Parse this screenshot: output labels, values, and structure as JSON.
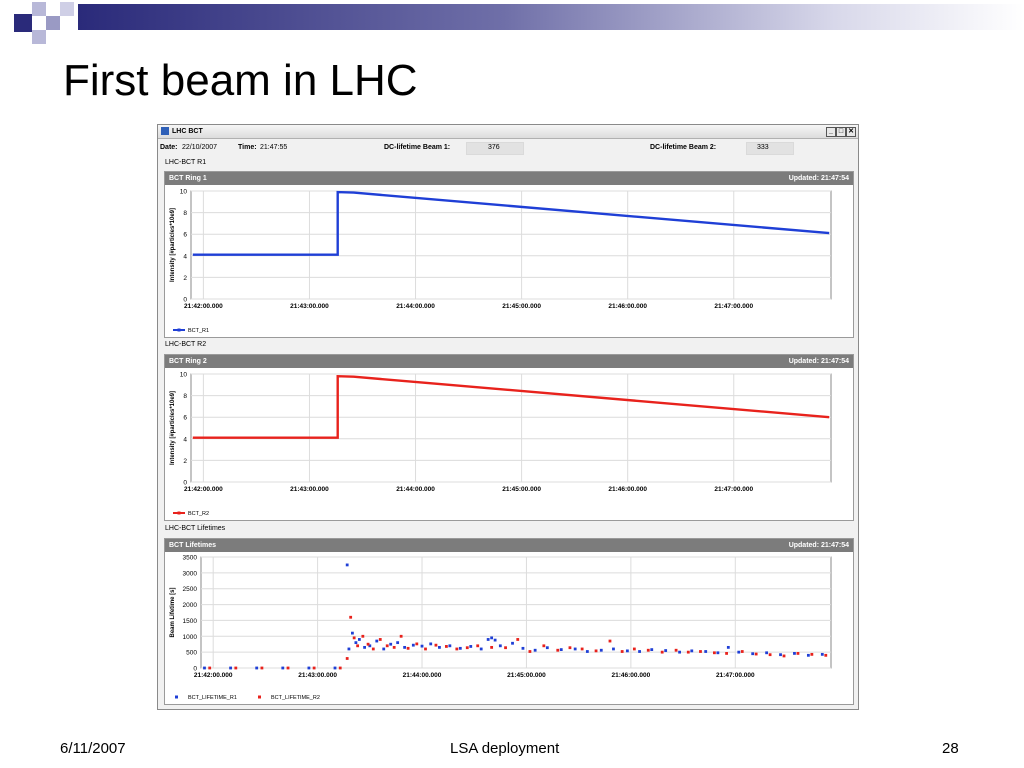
{
  "slide": {
    "title": "First beam in LHC"
  },
  "footer": {
    "date": "6/11/2007",
    "center": "LSA deployment",
    "page": "28"
  },
  "window": {
    "title": "LHC BCT",
    "date_label": "Date:",
    "date_value": "22/10/2007",
    "time_label": "Time:",
    "time_value": "21:47:55",
    "beam1_label": "DC-lifetime Beam 1:",
    "beam1_value": "376",
    "beam2_label": "DC-lifetime Beam 2:",
    "beam2_value": "333",
    "controls": {
      "minimize": "_",
      "maximize": "□",
      "close": "✕"
    }
  },
  "sections": [
    {
      "label": "LHC-BCT R1",
      "panel_title": "BCT Ring 1",
      "updated": "Updated: 21:47:54"
    },
    {
      "label": "LHC-BCT R2",
      "panel_title": "BCT Ring 2",
      "updated": "Updated: 21:47:54"
    },
    {
      "label": "LHC-BCT Lifetimes",
      "panel_title": "BCT Lifetimes",
      "updated": "Updated: 21:47:54"
    }
  ],
  "colors": {
    "r1": "#1f3fd6",
    "r2": "#e8221c",
    "panel_header": "#7c7c7c",
    "accent": "#2a2a7a"
  },
  "chart_data": [
    {
      "type": "line",
      "title": "BCT Ring 1",
      "ylabel": "Intensity [#particles*10e9]",
      "x_ticks": [
        "21:42:00.000",
        "21:43:00.000",
        "21:44:00.000",
        "21:45:00.000",
        "21:46:00.000",
        "21:47:00.000"
      ],
      "ylim": [
        0,
        10
      ],
      "y_ticks": [
        0,
        2,
        4,
        6,
        8,
        10
      ],
      "grid": true,
      "legend": "bottom-left",
      "series": [
        {
          "name": "BCT_R1",
          "color": "#1f3fd6",
          "points": [
            [
              "21:41:54",
              4.1
            ],
            [
              "21:43:16",
              4.1
            ],
            [
              "21:43:16",
              9.9
            ],
            [
              "21:43:25",
              9.85
            ],
            [
              "21:47:54",
              6.1
            ]
          ]
        }
      ]
    },
    {
      "type": "line",
      "title": "BCT Ring 2",
      "ylabel": "Intensity [#particles*10e9]",
      "x_ticks": [
        "21:42:00.000",
        "21:43:00.000",
        "21:44:00.000",
        "21:45:00.000",
        "21:46:00.000",
        "21:47:00.000"
      ],
      "ylim": [
        0,
        10
      ],
      "y_ticks": [
        0,
        2,
        4,
        6,
        8,
        10
      ],
      "grid": true,
      "legend": "bottom-left",
      "series": [
        {
          "name": "BCT_R2",
          "color": "#e8221c",
          "points": [
            [
              "21:41:54",
              4.1
            ],
            [
              "21:43:16",
              4.1
            ],
            [
              "21:43:16",
              9.8
            ],
            [
              "21:43:25",
              9.75
            ],
            [
              "21:47:54",
              6.0
            ]
          ]
        }
      ]
    },
    {
      "type": "scatter",
      "title": "BCT Lifetimes",
      "ylabel": "Beam Lifetime [s]",
      "x_ticks": [
        "21:42:00.000",
        "21:43:00.000",
        "21:44:00.000",
        "21:45:00.000",
        "21:46:00.000",
        "21:47:00.000"
      ],
      "ylim": [
        0,
        3500
      ],
      "y_ticks": [
        0,
        500,
        1000,
        1500,
        2000,
        2500,
        3000,
        3500
      ],
      "grid": true,
      "legend": "bottom-left",
      "series": [
        {
          "name": "BCT_LIFETIME_R1",
          "color": "#1f3fd6",
          "marker": "square",
          "points": [
            [
              "21:41:55",
              0
            ],
            [
              "21:42:10",
              0
            ],
            [
              "21:42:25",
              0
            ],
            [
              "21:42:40",
              0
            ],
            [
              "21:42:55",
              0
            ],
            [
              "21:43:10",
              0
            ],
            [
              "21:43:17",
              3250
            ],
            [
              "21:43:18",
              600
            ],
            [
              "21:43:20",
              1100
            ],
            [
              "21:43:22",
              800
            ],
            [
              "21:43:24",
              900
            ],
            [
              "21:43:27",
              650
            ],
            [
              "21:43:30",
              700
            ],
            [
              "21:43:34",
              850
            ],
            [
              "21:43:38",
              600
            ],
            [
              "21:43:42",
              750
            ],
            [
              "21:43:46",
              800
            ],
            [
              "21:43:50",
              650
            ],
            [
              "21:43:55",
              720
            ],
            [
              "21:44:00",
              690
            ],
            [
              "21:44:05",
              760
            ],
            [
              "21:44:10",
              650
            ],
            [
              "21:44:16",
              700
            ],
            [
              "21:44:22",
              620
            ],
            [
              "21:44:28",
              680
            ],
            [
              "21:44:34",
              600
            ],
            [
              "21:44:38",
              900
            ],
            [
              "21:44:40",
              950
            ],
            [
              "21:44:42",
              880
            ],
            [
              "21:44:45",
              700
            ],
            [
              "21:44:52",
              780
            ],
            [
              "21:44:58",
              620
            ],
            [
              "21:45:05",
              560
            ],
            [
              "21:45:12",
              640
            ],
            [
              "21:45:20",
              580
            ],
            [
              "21:45:28",
              600
            ],
            [
              "21:45:35",
              520
            ],
            [
              "21:45:43",
              560
            ],
            [
              "21:45:50",
              600
            ],
            [
              "21:45:58",
              540
            ],
            [
              "21:46:05",
              520
            ],
            [
              "21:46:12",
              580
            ],
            [
              "21:46:20",
              550
            ],
            [
              "21:46:28",
              500
            ],
            [
              "21:46:35",
              540
            ],
            [
              "21:46:43",
              520
            ],
            [
              "21:46:50",
              480
            ],
            [
              "21:46:56",
              650
            ],
            [
              "21:47:02",
              500
            ],
            [
              "21:47:10",
              450
            ],
            [
              "21:47:18",
              480
            ],
            [
              "21:47:26",
              420
            ],
            [
              "21:47:34",
              460
            ],
            [
              "21:47:42",
              400
            ],
            [
              "21:47:50",
              430
            ]
          ]
        },
        {
          "name": "BCT_LIFETIME_R2",
          "color": "#e8221c",
          "marker": "square",
          "points": [
            [
              "21:41:58",
              0
            ],
            [
              "21:42:13",
              0
            ],
            [
              "21:42:28",
              0
            ],
            [
              "21:42:43",
              0
            ],
            [
              "21:42:58",
              0
            ],
            [
              "21:43:13",
              0
            ],
            [
              "21:43:17",
              300
            ],
            [
              "21:43:19",
              1600
            ],
            [
              "21:43:21",
              950
            ],
            [
              "21:43:23",
              700
            ],
            [
              "21:43:26",
              1000
            ],
            [
              "21:43:29",
              750
            ],
            [
              "21:43:32",
              600
            ],
            [
              "21:43:36",
              900
            ],
            [
              "21:43:40",
              700
            ],
            [
              "21:43:44",
              650
            ],
            [
              "21:43:48",
              1000
            ],
            [
              "21:43:52",
              620
            ],
            [
              "21:43:57",
              760
            ],
            [
              "21:44:02",
              600
            ],
            [
              "21:44:08",
              720
            ],
            [
              "21:44:14",
              680
            ],
            [
              "21:44:20",
              600
            ],
            [
              "21:44:26",
              640
            ],
            [
              "21:44:32",
              700
            ],
            [
              "21:44:40",
              650
            ],
            [
              "21:44:48",
              640
            ],
            [
              "21:44:55",
              900
            ],
            [
              "21:45:02",
              520
            ],
            [
              "21:45:10",
              700
            ],
            [
              "21:45:18",
              560
            ],
            [
              "21:45:25",
              640
            ],
            [
              "21:45:32",
              600
            ],
            [
              "21:45:40",
              540
            ],
            [
              "21:45:48",
              850
            ],
            [
              "21:45:55",
              520
            ],
            [
              "21:46:02",
              600
            ],
            [
              "21:46:10",
              560
            ],
            [
              "21:46:18",
              500
            ],
            [
              "21:46:26",
              560
            ],
            [
              "21:46:33",
              500
            ],
            [
              "21:46:40",
              520
            ],
            [
              "21:46:48",
              480
            ],
            [
              "21:46:55",
              460
            ],
            [
              "21:47:04",
              520
            ],
            [
              "21:47:12",
              440
            ],
            [
              "21:47:20",
              420
            ],
            [
              "21:47:28",
              380
            ],
            [
              "21:47:36",
              460
            ],
            [
              "21:47:44",
              430
            ],
            [
              "21:47:52",
              400
            ]
          ]
        }
      ]
    }
  ]
}
